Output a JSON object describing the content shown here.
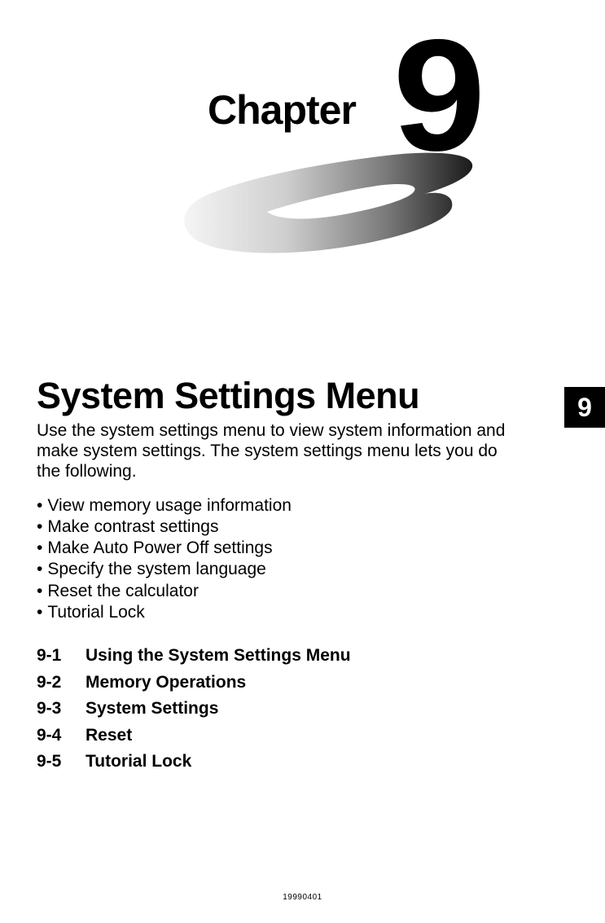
{
  "chapter": {
    "label": "Chapter",
    "number": "9",
    "tab": "9"
  },
  "title": "System Settings Menu",
  "intro": "Use the system settings menu to view system information and make system settings. The system settings menu lets you do the following.",
  "bullets": [
    "View memory usage information",
    "Make contrast settings",
    "Make Auto Power Off settings",
    "Specify the system language",
    "Reset the calculator",
    "Tutorial Lock"
  ],
  "toc": [
    {
      "num": "9-1",
      "title": "Using the System Settings Menu"
    },
    {
      "num": "9-2",
      "title": "Memory Operations"
    },
    {
      "num": "9-3",
      "title": "System Settings"
    },
    {
      "num": "9-4",
      "title": "Reset"
    },
    {
      "num": "9-5",
      "title": "Tutorial Lock"
    }
  ],
  "footer": "19990401"
}
